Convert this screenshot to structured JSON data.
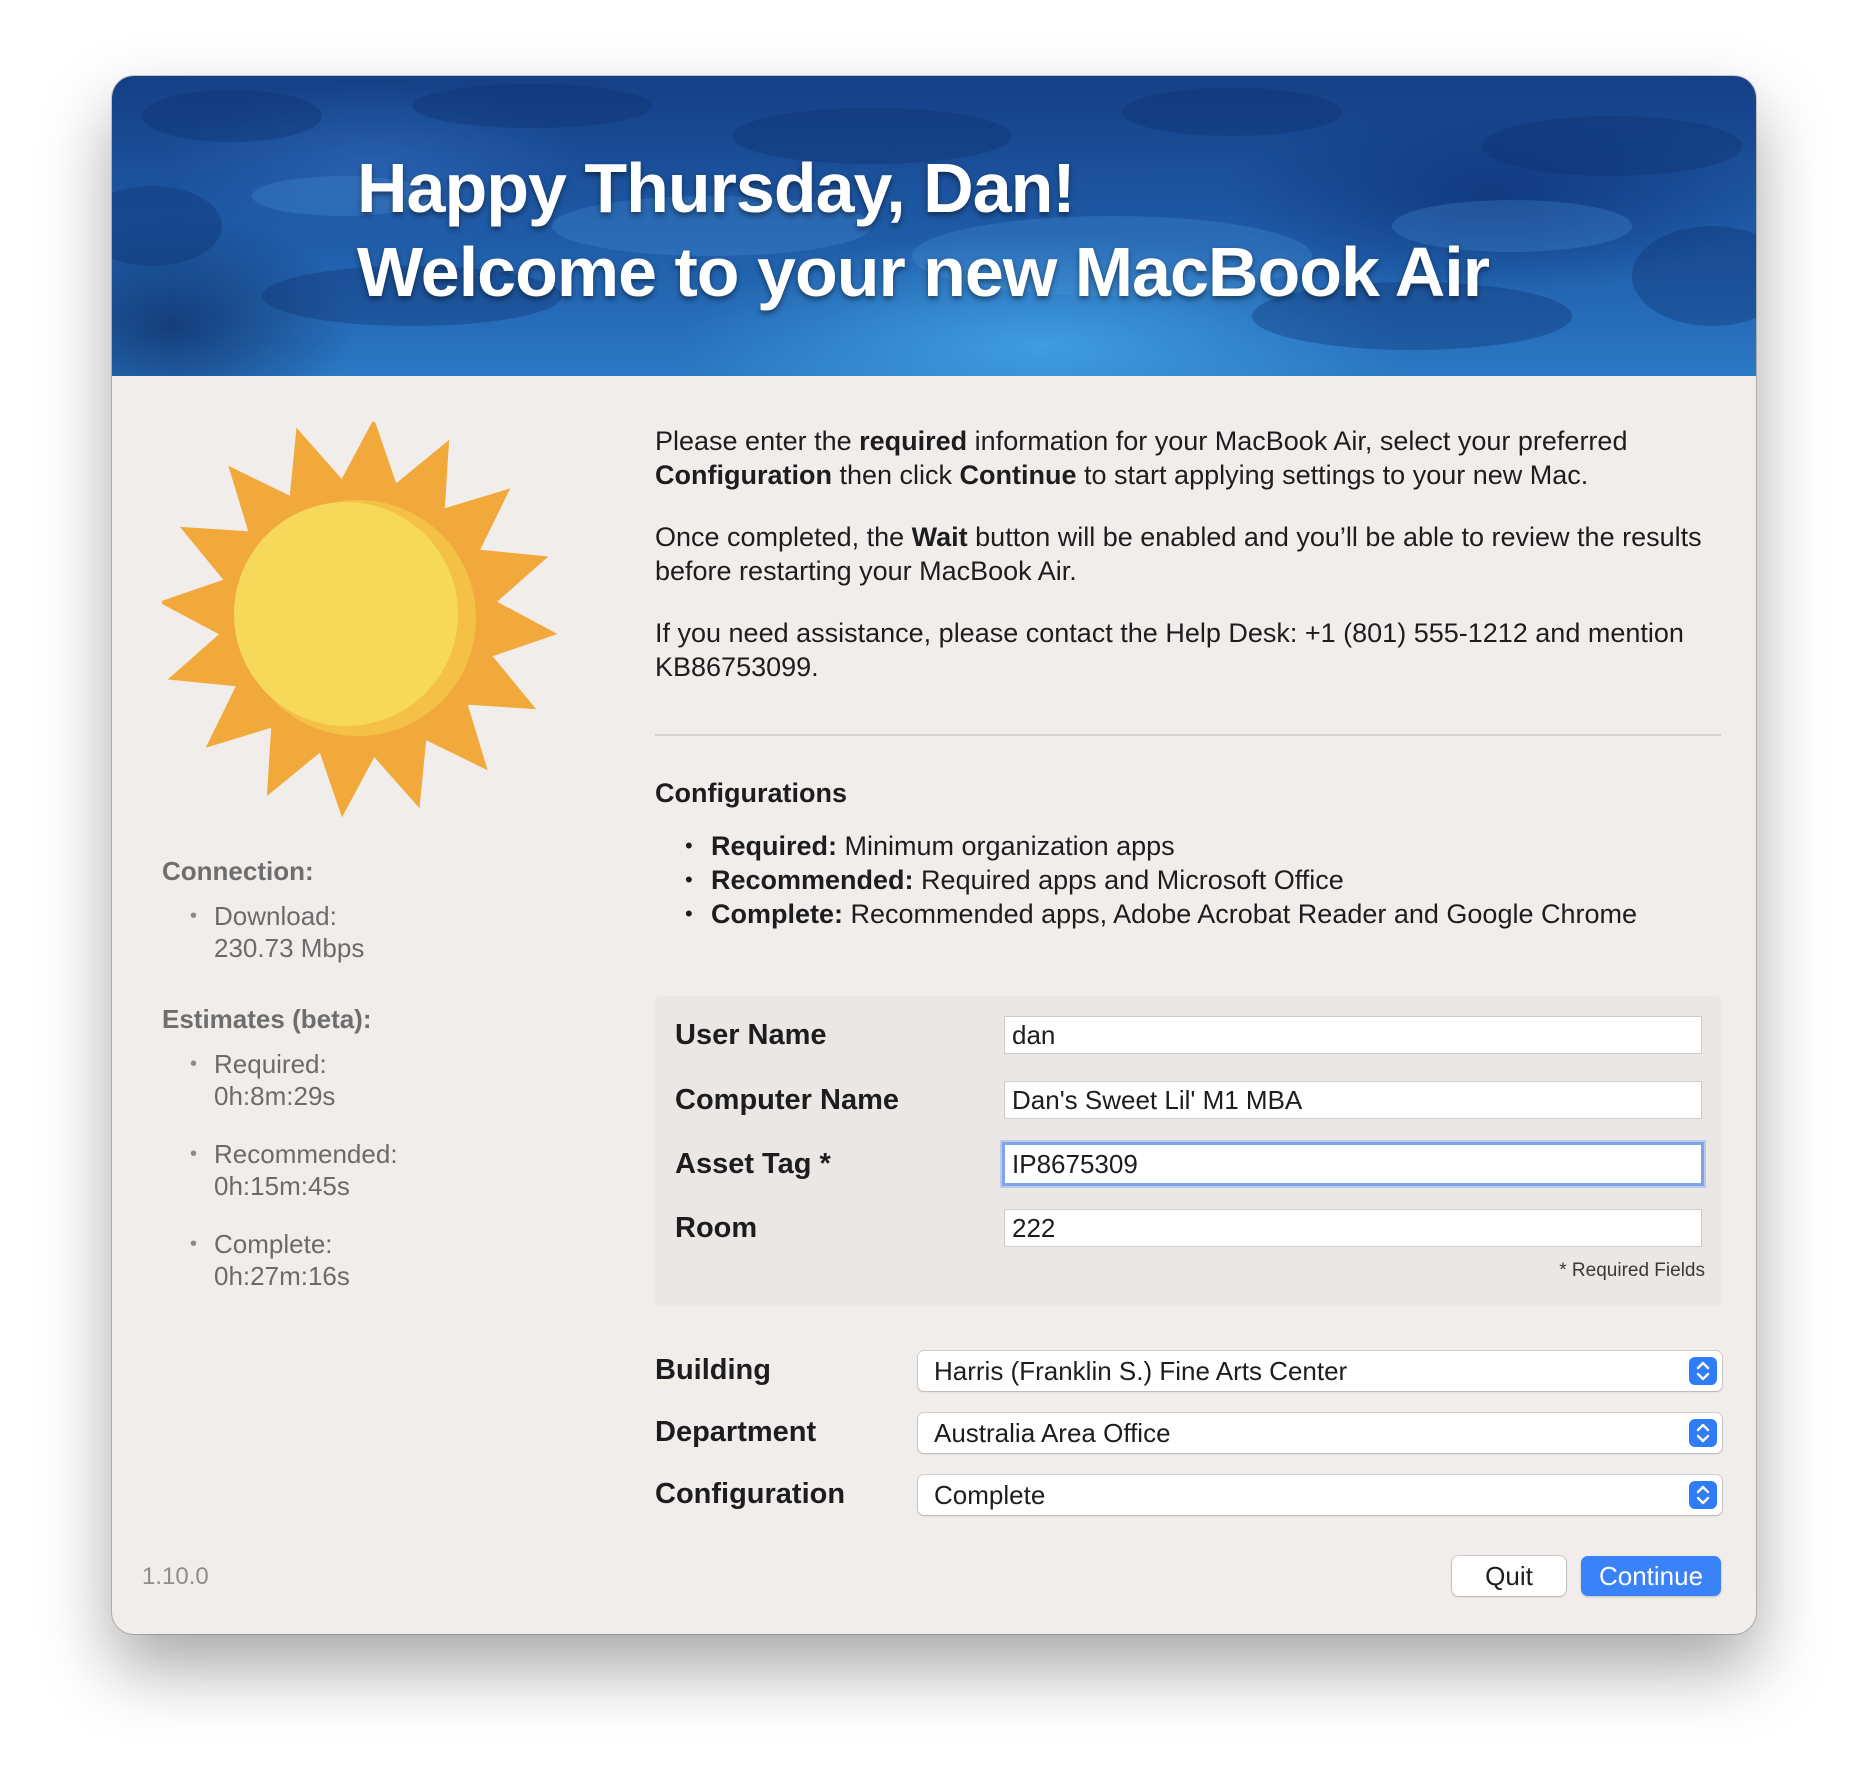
{
  "header": {
    "greeting": "Happy Thursday, Dan!",
    "welcome": "Welcome to your new MacBook Air"
  },
  "intro": {
    "p1": [
      {
        "t": "Please enter the ",
        "b": false
      },
      {
        "t": "required",
        "b": true
      },
      {
        "t": " information for your MacBook Air, select your preferred ",
        "b": false
      },
      {
        "t": "Configuration",
        "b": true
      },
      {
        "t": " then click ",
        "b": false
      },
      {
        "t": "Continue",
        "b": true
      },
      {
        "t": " to start applying settings to your new Mac.",
        "b": false
      }
    ],
    "p2": [
      {
        "t": "Once completed, the ",
        "b": false
      },
      {
        "t": "Wait",
        "b": true
      },
      {
        "t": " button will be enabled and you’ll be able to review the results before restarting your MacBook Air.",
        "b": false
      }
    ],
    "p3": [
      {
        "t": "If you need assistance, please contact the Help Desk: +1 (801) 555-1212 and mention KB86753099.",
        "b": false
      }
    ]
  },
  "configurations": {
    "heading": "Configurations",
    "items": [
      {
        "name": "Required:",
        "desc": " Minimum organization apps"
      },
      {
        "name": "Recommended:",
        "desc": " Required apps and Microsoft Office"
      },
      {
        "name": "Complete:",
        "desc": " Recommended apps, Adobe Acrobat Reader and Google Chrome"
      }
    ]
  },
  "sidebar": {
    "icon": "sun-icon",
    "connection_heading": "Connection:",
    "download_label": "Download:",
    "download_value": "230.73 Mbps",
    "estimates_heading": "Estimates (beta):",
    "estimates": [
      {
        "label": "Required:",
        "value": "0h:8m:29s"
      },
      {
        "label": "Recommended:",
        "value": "0h:15m:45s"
      },
      {
        "label": "Complete:",
        "value": "0h:27m:16s"
      }
    ]
  },
  "form": {
    "fields": [
      {
        "label": "User Name",
        "value": "dan"
      },
      {
        "label": "Computer Name",
        "value": "Dan's Sweet Lil' M1 MBA"
      },
      {
        "label": "Asset Tag *",
        "value": "IP8675309"
      },
      {
        "label": "Room",
        "value": "222"
      }
    ],
    "required_note": "* Required Fields"
  },
  "selects": [
    {
      "label": "Building",
      "value": "Harris (Franklin S.) Fine Arts Center"
    },
    {
      "label": "Department",
      "value": "Australia Area Office"
    },
    {
      "label": "Configuration",
      "value": "Complete"
    }
  ],
  "footer": {
    "version": "1.10.0",
    "quit_label": "Quit",
    "continue_label": "Continue"
  },
  "colors": {
    "accent": "#3a82f7",
    "sun_ray": "#f2a93b",
    "sun_core": "#f7d95a",
    "window_bg": "#f1edeb"
  }
}
